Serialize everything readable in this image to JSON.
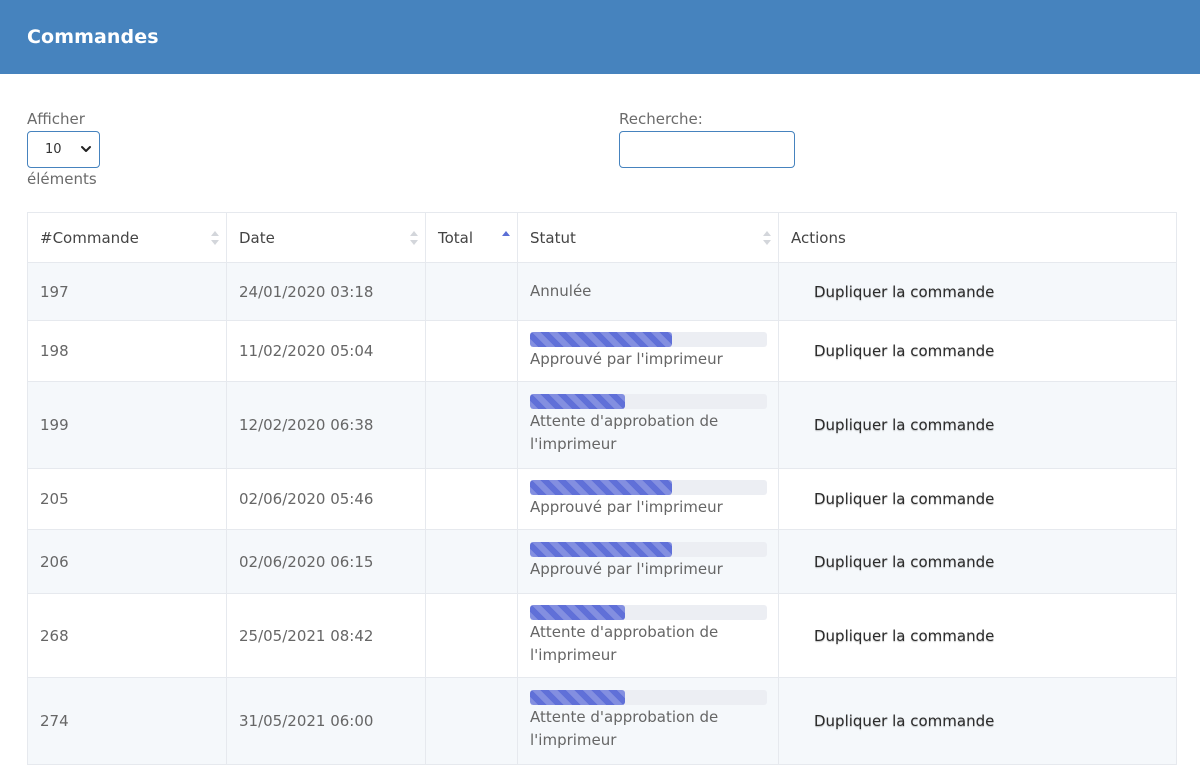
{
  "header": {
    "title": "Commandes"
  },
  "length": {
    "label": "Afficher",
    "value": "10",
    "suffix": "éléments"
  },
  "search": {
    "label": "Recherche:",
    "value": ""
  },
  "table": {
    "columns": [
      "#Commande",
      "Date",
      "Total",
      "Statut",
      "Actions"
    ],
    "sorted_column": "Total",
    "sort_direction": "ascending",
    "rows": [
      {
        "id": "197",
        "date": "24/01/2020 03:18",
        "total": "",
        "status": "Annulée",
        "progress": null,
        "action": "Dupliquer la commande"
      },
      {
        "id": "198",
        "date": "11/02/2020 05:04",
        "total": "",
        "status": "Approuvé par l'imprimeur",
        "progress": 0.6,
        "action": "Dupliquer la commande"
      },
      {
        "id": "199",
        "date": "12/02/2020 06:38",
        "total": "",
        "status": "Attente d'approbation de l'imprimeur",
        "progress": 0.4,
        "action": "Dupliquer la commande"
      },
      {
        "id": "205",
        "date": "02/06/2020 05:46",
        "total": "",
        "status": "Approuvé par l'imprimeur",
        "progress": 0.6,
        "action": "Dupliquer la commande"
      },
      {
        "id": "206",
        "date": "02/06/2020 06:15",
        "total": "",
        "status": "Approuvé par l'imprimeur",
        "progress": 0.6,
        "action": "Dupliquer la commande"
      },
      {
        "id": "268",
        "date": "25/05/2021 08:42",
        "total": "",
        "status": "Attente d'approbation de l'imprimeur",
        "progress": 0.4,
        "action": "Dupliquer la commande"
      },
      {
        "id": "274",
        "date": "31/05/2021 06:00",
        "total": "",
        "status": "Attente d'approbation de l'imprimeur",
        "progress": 0.4,
        "action": "Dupliquer la commande"
      }
    ]
  },
  "colors": {
    "header_bg": "#4683be",
    "progress_fill": "#6070d8",
    "progress_track": "#eceef3",
    "row_stripe": "#f5f8fb"
  }
}
